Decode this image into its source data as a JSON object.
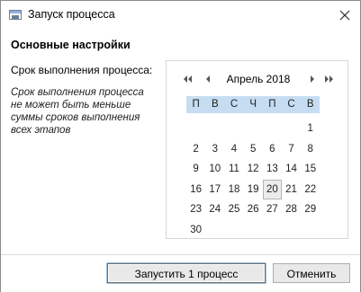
{
  "window": {
    "title": "Запуск процесса"
  },
  "section": {
    "title": "Основные настройки"
  },
  "field": {
    "label": "Срок выполнения процесса:",
    "hint": "Срок выполнения процесса не может быть меньше суммы сроков выполнения всех этапов"
  },
  "calendar": {
    "month_label": "Апрель 2018",
    "weekdays": [
      "П",
      "В",
      "С",
      "Ч",
      "П",
      "С",
      "В"
    ],
    "leading_blanks": 6,
    "days": [
      1,
      2,
      3,
      4,
      5,
      6,
      7,
      8,
      9,
      10,
      11,
      12,
      13,
      14,
      15,
      16,
      17,
      18,
      19,
      20,
      21,
      22,
      23,
      24,
      25,
      26,
      27,
      28,
      29,
      30
    ],
    "selected_day": 20,
    "icons": {
      "prev_year": "double-chevron-left-icon",
      "prev_month": "chevron-left-icon",
      "next_month": "chevron-right-icon",
      "next_year": "double-chevron-right-icon"
    },
    "header_color": "#c6ddf1"
  },
  "buttons": {
    "start_label": "Запустить 1 процесс",
    "cancel_label": "Отменить"
  }
}
